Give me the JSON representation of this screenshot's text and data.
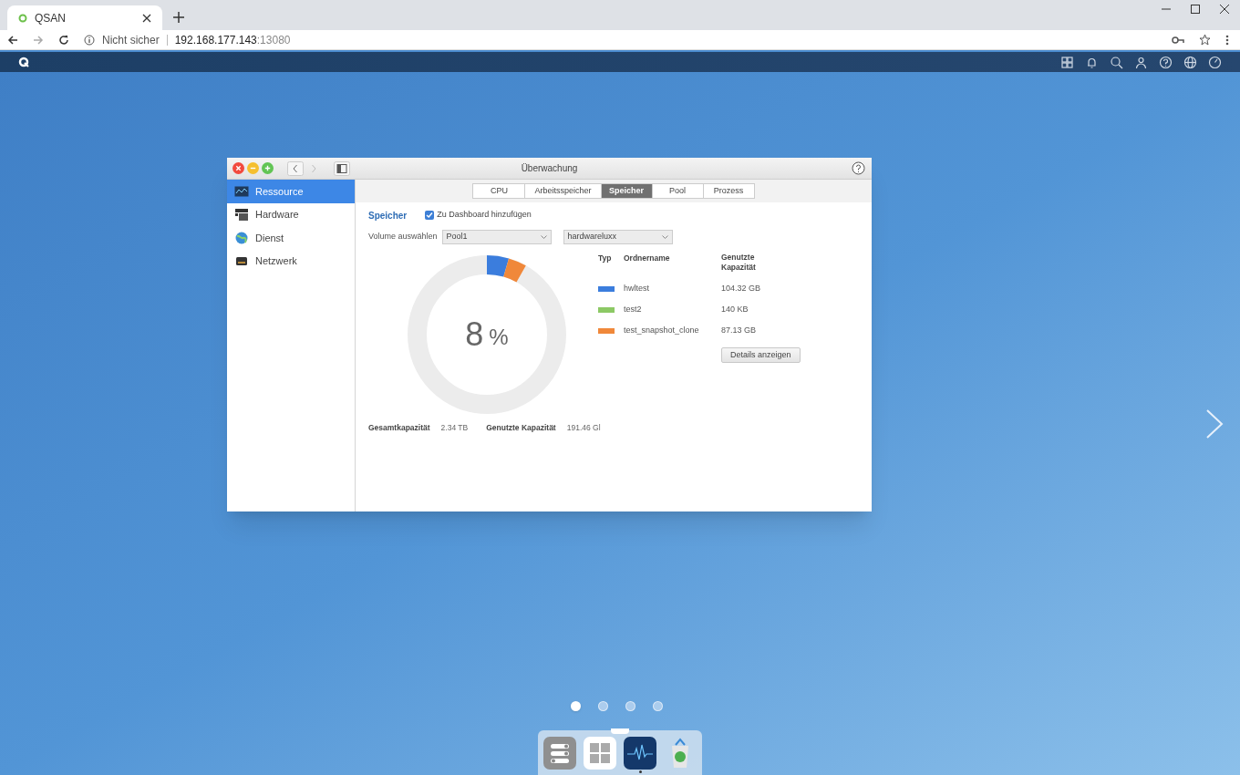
{
  "browser": {
    "tab_title": "QSAN",
    "security": "Nicht sicher",
    "url_host": "192.168.177.143",
    "url_port": ":13080"
  },
  "window": {
    "title": "Überwachung"
  },
  "sidebar": {
    "items": [
      {
        "label": "Ressource",
        "kind": "chart",
        "selected": true
      },
      {
        "label": "Hardware",
        "kind": "hardware",
        "selected": false
      },
      {
        "label": "Dienst",
        "kind": "globe",
        "selected": false
      },
      {
        "label": "Netzwerk",
        "kind": "network",
        "selected": false
      }
    ]
  },
  "tabs": [
    {
      "label": "CPU",
      "selected": false
    },
    {
      "label": "Arbeitsspeicher",
      "selected": false
    },
    {
      "label": "Speicher",
      "selected": true
    },
    {
      "label": "Pool",
      "selected": false
    },
    {
      "label": "Prozess",
      "selected": false
    }
  ],
  "section": {
    "title": "Speicher",
    "dashboard_checkbox": {
      "label": "Zu Dashboard hinzufügen",
      "checked": true
    }
  },
  "volume_select": {
    "label": "Volume auswählen",
    "value": "Pool1"
  },
  "folder_select": {
    "value": "hardwareluxx"
  },
  "usage": {
    "percent": "8",
    "unit": "%"
  },
  "legend": {
    "columns": [
      "Typ",
      "Ordnername",
      "Genutzte Kapazität"
    ],
    "rows": [
      {
        "name": "hwltest",
        "used": "104.32 GB",
        "color": "#3b7ddd"
      },
      {
        "name": "test2",
        "used": "140 KB",
        "color": "#8cc965"
      },
      {
        "name": "test_snapshot_clone",
        "used": "87.13 GB",
        "color": "#f0883a"
      }
    ]
  },
  "details_button": "Details anzeigen",
  "summary": [
    {
      "label": "Gesamtkapazität",
      "value": "2.34 TB"
    },
    {
      "label": "Genutzte Kapazität",
      "value": "191.46 Gl"
    }
  ],
  "pager": [
    {
      "selected": true
    },
    {
      "selected": false
    },
    {
      "selected": false
    },
    {
      "selected": false
    }
  ],
  "dock": [
    {
      "kind": "settings",
      "active": false
    },
    {
      "kind": "apps",
      "active": false
    },
    {
      "kind": "monitor",
      "active": true
    },
    {
      "kind": "trash",
      "active": false
    }
  ]
}
